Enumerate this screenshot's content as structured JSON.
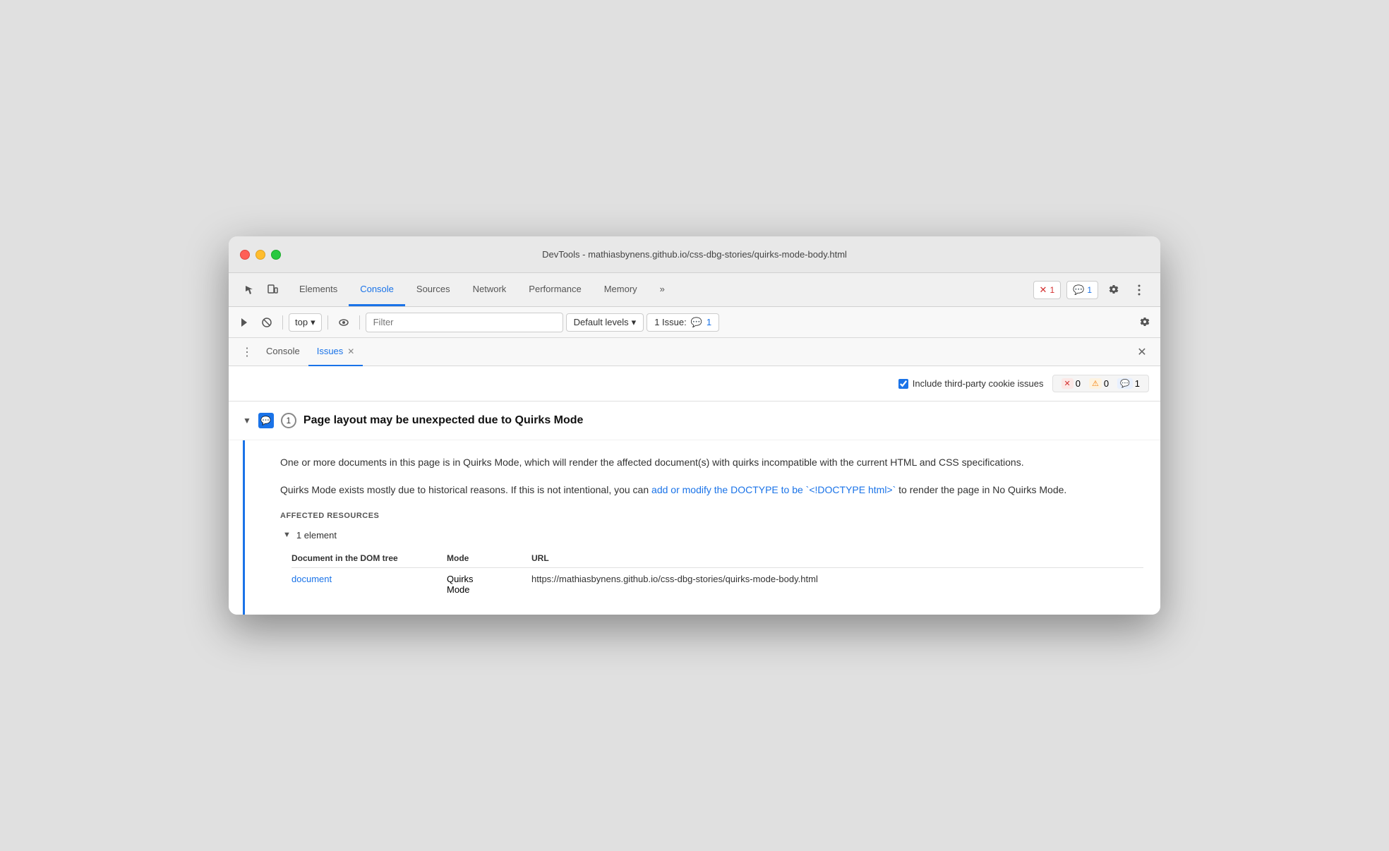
{
  "window": {
    "title": "DevTools - mathiasbynens.github.io/css-dbg-stories/quirks-mode-body.html"
  },
  "tabs": {
    "items": [
      {
        "id": "elements",
        "label": "Elements",
        "active": false
      },
      {
        "id": "console",
        "label": "Console",
        "active": true
      },
      {
        "id": "sources",
        "label": "Sources",
        "active": false
      },
      {
        "id": "network",
        "label": "Network",
        "active": false
      },
      {
        "id": "performance",
        "label": "Performance",
        "active": false
      },
      {
        "id": "memory",
        "label": "Memory",
        "active": false
      },
      {
        "id": "more",
        "label": "»",
        "active": false
      }
    ],
    "error_count": "1",
    "message_count": "1"
  },
  "toolbar": {
    "execute_label": "▶",
    "clear_label": "🚫",
    "context_label": "top",
    "eye_label": "👁",
    "filter_placeholder": "Filter",
    "levels_label": "Default levels",
    "issue_label": "1 Issue:",
    "issue_count": "1"
  },
  "panel": {
    "dots": "⋮",
    "tabs": [
      {
        "id": "console",
        "label": "Console",
        "active": false,
        "closable": false
      },
      {
        "id": "issues",
        "label": "Issues",
        "active": true,
        "closable": true
      }
    ],
    "close_label": "✕"
  },
  "issues_filter": {
    "checkbox_label": "Include third-party cookie issues",
    "checked": true,
    "counts": [
      {
        "type": "error",
        "color": "#d32f2f",
        "bg": "#fce8e6",
        "count": "0",
        "icon": "✕"
      },
      {
        "type": "warning",
        "color": "#f57c00",
        "bg": "#fef3e0",
        "count": "0",
        "icon": "⚠"
      },
      {
        "type": "info",
        "color": "#1a73e8",
        "bg": "#e8f0fe",
        "count": "1",
        "icon": "💬"
      }
    ]
  },
  "issue": {
    "title": "Page layout may be unexpected due to Quirks Mode",
    "count": "1",
    "description1": "One or more documents in this page is in Quirks Mode, which will render the affected document(s) with quirks incompatible with the current HTML and CSS specifications.",
    "description2_before": "Quirks Mode exists mostly due to historical reasons. If this is not intentional, you can ",
    "description2_link": "add or modify the DOCTYPE to be `<!DOCTYPE html>`",
    "description2_after": " to render the page in No Quirks Mode.",
    "affected_label": "AFFECTED RESOURCES",
    "element_count": "1 element",
    "table_headers": {
      "col1": "Document in the DOM tree",
      "col2": "Mode",
      "col3": "URL"
    },
    "table_row": {
      "col1": "document",
      "col1_link": true,
      "col2": "Quirks Mode",
      "col3": "https://mathiasbynens.github.io/css-dbg-stories/quirks-mode-body.html"
    }
  },
  "colors": {
    "blue": "#1a73e8",
    "red": "#d32f2f",
    "orange": "#f57c00"
  }
}
